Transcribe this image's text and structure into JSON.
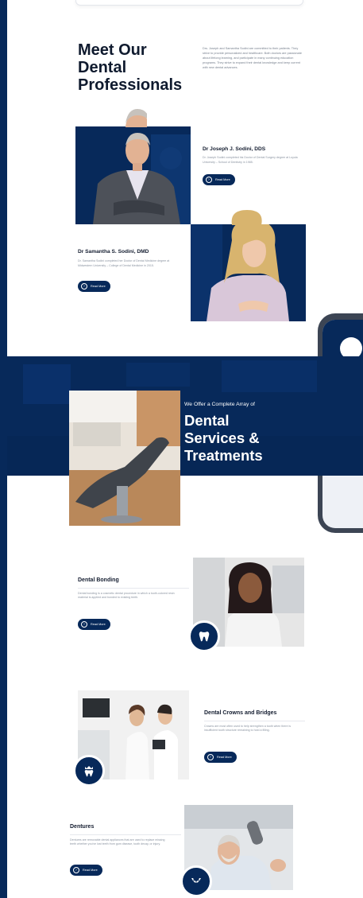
{
  "team": {
    "title_lines": [
      "Meet Our",
      "Dental",
      "Professionals"
    ],
    "intro": "Drs. Joseph and Samantha Sodini are committed to their patients. They strive to provide personalized and healthcare. Both doctors are passionate about lifelong learning, and participate in many continuing education programs. They strive to expand their dental knowledge and keep current with new dental advances.",
    "members": [
      {
        "name": "Dr Joseph J. Sodini, DDS",
        "desc": "Dr. Joseph Sodini completed his Doctor of Dental Surgery degree at Loyola University – School of Dentistry in 1985.",
        "button": "Read More"
      },
      {
        "name": "Dr Samantha S. Sodini, DMD",
        "desc": "Dr. Samantha Sodini completed her Doctor of Dental Medicine degree at Midwestern University – College of Dental Medicine in 2015.",
        "button": "Read More"
      }
    ]
  },
  "services_banner": {
    "subtitle": "We Offer a Complete Array of",
    "title_lines": [
      "Dental",
      "Services &",
      "Treatments"
    ]
  },
  "services": [
    {
      "title": "Dental Bonding",
      "desc": "Dental bonding is a cosmetic dental procedure in which a tooth-colored resin material is applied and bonded to existing teeth.",
      "button": "Read More",
      "icon": "tooth-icon"
    },
    {
      "title": "Dental Crowns and Bridges",
      "desc": "Crowns are most often used to help strengthen a tooth when there is insufficient tooth structure remaining to hold a filling.",
      "button": "Read More",
      "icon": "crown-tooth-icon"
    },
    {
      "title": "Dentures",
      "desc": "Dentures are removable dental appliances that are used to replace missing teeth whether you've lost teeth from gum disease, tooth decay, or injury.",
      "button": "Read More",
      "icon": "dentures-icon"
    }
  ],
  "colors": {
    "navy": "#07295a",
    "text_dark": "#141d30",
    "text_muted": "#8a93a0"
  }
}
